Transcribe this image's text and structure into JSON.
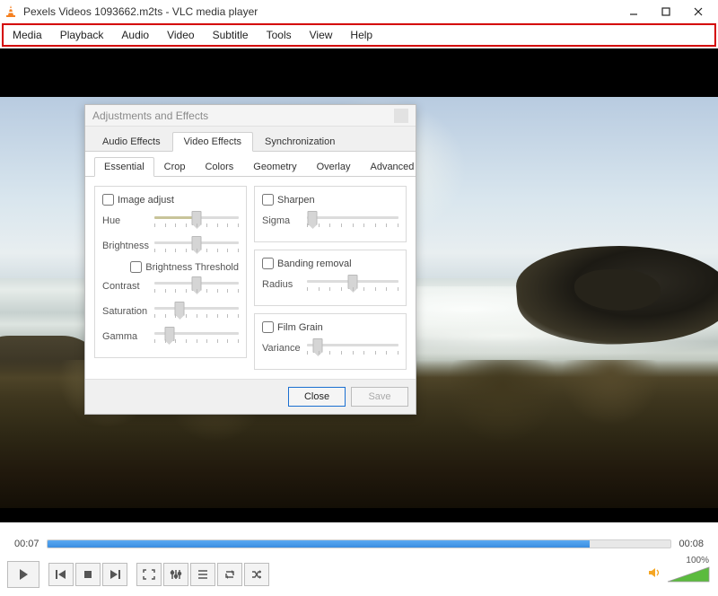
{
  "window": {
    "title": "Pexels Videos 1093662.m2ts - VLC media player"
  },
  "menu": {
    "items": [
      "Media",
      "Playback",
      "Audio",
      "Video",
      "Subtitle",
      "Tools",
      "View",
      "Help"
    ]
  },
  "dialog": {
    "title": "Adjustments and Effects",
    "topTabs": [
      "Audio Effects",
      "Video Effects",
      "Synchronization"
    ],
    "topActive": 1,
    "subTabs": [
      "Essential",
      "Crop",
      "Colors",
      "Geometry",
      "Overlay",
      "Advanced"
    ],
    "subActive": 0,
    "imageAdjust": {
      "label": "Image adjust",
      "hue": {
        "label": "Hue",
        "pos": 50
      },
      "brightness": {
        "label": "Brightness",
        "pos": 50
      },
      "brightnessThreshold": "Brightness Threshold",
      "contrast": {
        "label": "Contrast",
        "pos": 50
      },
      "saturation": {
        "label": "Saturation",
        "pos": 30
      },
      "gamma": {
        "label": "Gamma",
        "pos": 18
      }
    },
    "sharpen": {
      "label": "Sharpen",
      "sigma": {
        "label": "Sigma",
        "pos": 6
      }
    },
    "banding": {
      "label": "Banding removal",
      "radius": {
        "label": "Radius",
        "pos": 50
      }
    },
    "filmGrain": {
      "label": "Film Grain",
      "variance": {
        "label": "Variance",
        "pos": 12
      }
    },
    "buttons": {
      "close": "Close",
      "save": "Save"
    }
  },
  "player": {
    "elapsed": "00:07",
    "total": "00:08",
    "seekPct": 87,
    "volumeLabel": "100%"
  }
}
